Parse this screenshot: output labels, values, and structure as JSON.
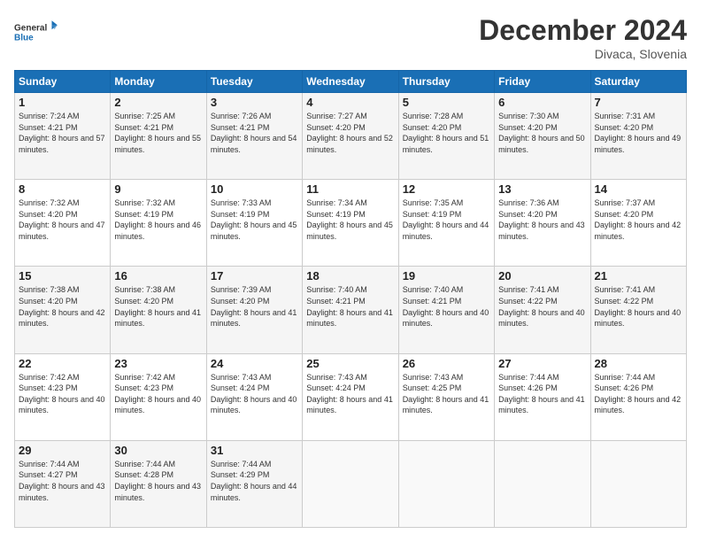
{
  "logo": {
    "line1": "General",
    "line2": "Blue"
  },
  "header": {
    "month_title": "December 2024",
    "location": "Divaca, Slovenia"
  },
  "weekdays": [
    "Sunday",
    "Monday",
    "Tuesday",
    "Wednesday",
    "Thursday",
    "Friday",
    "Saturday"
  ],
  "weeks": [
    [
      {
        "day": "1",
        "sunrise": "7:24 AM",
        "sunset": "4:21 PM",
        "daylight": "8 hours and 57 minutes."
      },
      {
        "day": "2",
        "sunrise": "7:25 AM",
        "sunset": "4:21 PM",
        "daylight": "8 hours and 55 minutes."
      },
      {
        "day": "3",
        "sunrise": "7:26 AM",
        "sunset": "4:21 PM",
        "daylight": "8 hours and 54 minutes."
      },
      {
        "day": "4",
        "sunrise": "7:27 AM",
        "sunset": "4:20 PM",
        "daylight": "8 hours and 52 minutes."
      },
      {
        "day": "5",
        "sunrise": "7:28 AM",
        "sunset": "4:20 PM",
        "daylight": "8 hours and 51 minutes."
      },
      {
        "day": "6",
        "sunrise": "7:30 AM",
        "sunset": "4:20 PM",
        "daylight": "8 hours and 50 minutes."
      },
      {
        "day": "7",
        "sunrise": "7:31 AM",
        "sunset": "4:20 PM",
        "daylight": "8 hours and 49 minutes."
      }
    ],
    [
      {
        "day": "8",
        "sunrise": "7:32 AM",
        "sunset": "4:20 PM",
        "daylight": "8 hours and 47 minutes."
      },
      {
        "day": "9",
        "sunrise": "7:32 AM",
        "sunset": "4:19 PM",
        "daylight": "8 hours and 46 minutes."
      },
      {
        "day": "10",
        "sunrise": "7:33 AM",
        "sunset": "4:19 PM",
        "daylight": "8 hours and 45 minutes."
      },
      {
        "day": "11",
        "sunrise": "7:34 AM",
        "sunset": "4:19 PM",
        "daylight": "8 hours and 45 minutes."
      },
      {
        "day": "12",
        "sunrise": "7:35 AM",
        "sunset": "4:19 PM",
        "daylight": "8 hours and 44 minutes."
      },
      {
        "day": "13",
        "sunrise": "7:36 AM",
        "sunset": "4:20 PM",
        "daylight": "8 hours and 43 minutes."
      },
      {
        "day": "14",
        "sunrise": "7:37 AM",
        "sunset": "4:20 PM",
        "daylight": "8 hours and 42 minutes."
      }
    ],
    [
      {
        "day": "15",
        "sunrise": "7:38 AM",
        "sunset": "4:20 PM",
        "daylight": "8 hours and 42 minutes."
      },
      {
        "day": "16",
        "sunrise": "7:38 AM",
        "sunset": "4:20 PM",
        "daylight": "8 hours and 41 minutes."
      },
      {
        "day": "17",
        "sunrise": "7:39 AM",
        "sunset": "4:20 PM",
        "daylight": "8 hours and 41 minutes."
      },
      {
        "day": "18",
        "sunrise": "7:40 AM",
        "sunset": "4:21 PM",
        "daylight": "8 hours and 41 minutes."
      },
      {
        "day": "19",
        "sunrise": "7:40 AM",
        "sunset": "4:21 PM",
        "daylight": "8 hours and 40 minutes."
      },
      {
        "day": "20",
        "sunrise": "7:41 AM",
        "sunset": "4:22 PM",
        "daylight": "8 hours and 40 minutes."
      },
      {
        "day": "21",
        "sunrise": "7:41 AM",
        "sunset": "4:22 PM",
        "daylight": "8 hours and 40 minutes."
      }
    ],
    [
      {
        "day": "22",
        "sunrise": "7:42 AM",
        "sunset": "4:23 PM",
        "daylight": "8 hours and 40 minutes."
      },
      {
        "day": "23",
        "sunrise": "7:42 AM",
        "sunset": "4:23 PM",
        "daylight": "8 hours and 40 minutes."
      },
      {
        "day": "24",
        "sunrise": "7:43 AM",
        "sunset": "4:24 PM",
        "daylight": "8 hours and 40 minutes."
      },
      {
        "day": "25",
        "sunrise": "7:43 AM",
        "sunset": "4:24 PM",
        "daylight": "8 hours and 41 minutes."
      },
      {
        "day": "26",
        "sunrise": "7:43 AM",
        "sunset": "4:25 PM",
        "daylight": "8 hours and 41 minutes."
      },
      {
        "day": "27",
        "sunrise": "7:44 AM",
        "sunset": "4:26 PM",
        "daylight": "8 hours and 41 minutes."
      },
      {
        "day": "28",
        "sunrise": "7:44 AM",
        "sunset": "4:26 PM",
        "daylight": "8 hours and 42 minutes."
      }
    ],
    [
      {
        "day": "29",
        "sunrise": "7:44 AM",
        "sunset": "4:27 PM",
        "daylight": "8 hours and 43 minutes."
      },
      {
        "day": "30",
        "sunrise": "7:44 AM",
        "sunset": "4:28 PM",
        "daylight": "8 hours and 43 minutes."
      },
      {
        "day": "31",
        "sunrise": "7:44 AM",
        "sunset": "4:29 PM",
        "daylight": "8 hours and 44 minutes."
      },
      null,
      null,
      null,
      null
    ]
  ],
  "labels": {
    "sunrise": "Sunrise:",
    "sunset": "Sunset:",
    "daylight": "Daylight:"
  }
}
